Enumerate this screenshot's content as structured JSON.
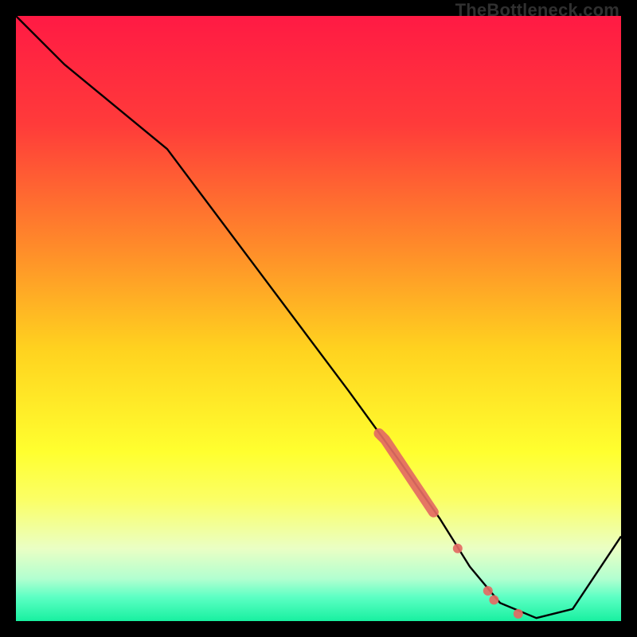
{
  "watermark": "TheBottleneck.com",
  "chart_data": {
    "type": "line",
    "title": "",
    "xlabel": "",
    "ylabel": "",
    "xlim": [
      0,
      100
    ],
    "ylim": [
      0,
      100
    ],
    "gradient_stops": [
      {
        "offset": 0,
        "color": "#ff1a44"
      },
      {
        "offset": 18,
        "color": "#ff3b3a"
      },
      {
        "offset": 38,
        "color": "#ff8a2a"
      },
      {
        "offset": 55,
        "color": "#ffd21f"
      },
      {
        "offset": 72,
        "color": "#ffff2f"
      },
      {
        "offset": 80,
        "color": "#fbff66"
      },
      {
        "offset": 88,
        "color": "#eaffc4"
      },
      {
        "offset": 93,
        "color": "#b2ffd0"
      },
      {
        "offset": 96,
        "color": "#5dffc4"
      },
      {
        "offset": 100,
        "color": "#18f0a0"
      }
    ],
    "series": [
      {
        "name": "bottleneck-curve",
        "x": [
          0,
          8,
          25,
          40,
          55,
          63,
          70,
          75,
          80,
          86,
          92,
          100
        ],
        "y": [
          100,
          92,
          78,
          58,
          38,
          27,
          17,
          9,
          3,
          0.5,
          2,
          14
        ]
      }
    ],
    "markers": {
      "cluster": {
        "name": "highlight-segment",
        "color": "#e36a63",
        "points": [
          {
            "x": 60,
            "y": 31
          },
          {
            "x": 61,
            "y": 30
          },
          {
            "x": 62,
            "y": 28.5
          },
          {
            "x": 63,
            "y": 27
          },
          {
            "x": 64,
            "y": 25.5
          },
          {
            "x": 65,
            "y": 24
          },
          {
            "x": 66,
            "y": 22.5
          },
          {
            "x": 67,
            "y": 21
          },
          {
            "x": 68,
            "y": 19.5
          },
          {
            "x": 69,
            "y": 18
          }
        ]
      },
      "singles": [
        {
          "name": "point-a",
          "x": 73,
          "y": 12,
          "color": "#e36a63"
        },
        {
          "name": "point-b",
          "x": 78,
          "y": 5,
          "color": "#e36a63"
        },
        {
          "name": "point-c",
          "x": 79,
          "y": 3.5,
          "color": "#e36a63"
        },
        {
          "name": "point-d",
          "x": 83,
          "y": 1.2,
          "color": "#e36a63"
        }
      ]
    }
  }
}
